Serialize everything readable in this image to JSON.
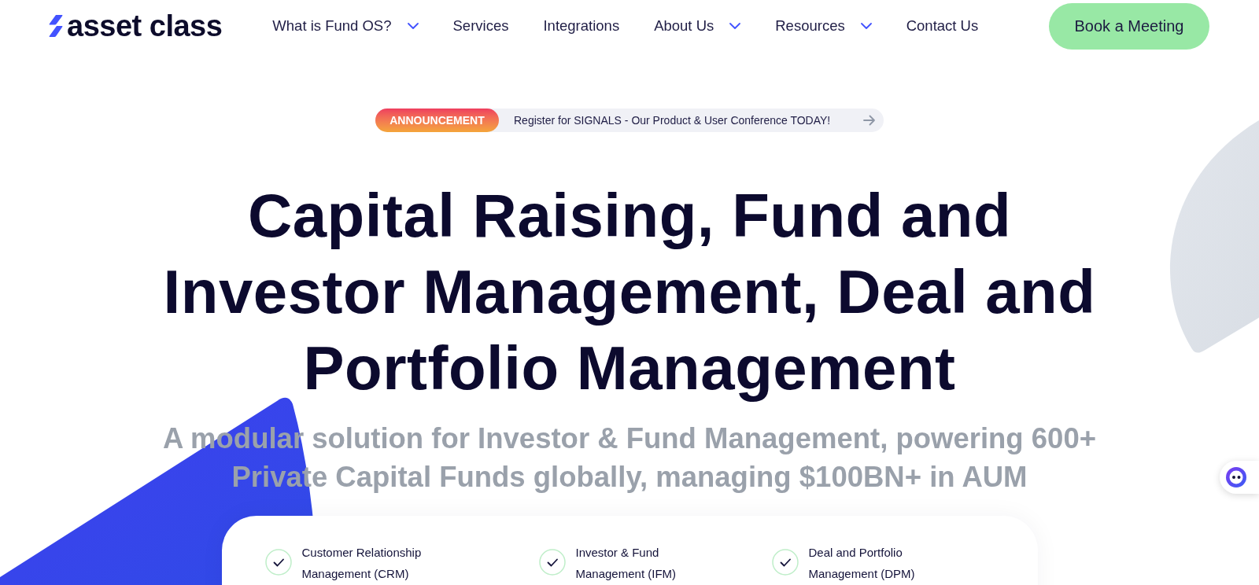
{
  "header": {
    "logo": {
      "text": "asset class"
    },
    "nav": [
      {
        "label": "What is Fund OS?",
        "dropdown": true
      },
      {
        "label": "Services",
        "dropdown": false
      },
      {
        "label": "Integrations",
        "dropdown": false
      },
      {
        "label": "About Us",
        "dropdown": true
      },
      {
        "label": "Resources",
        "dropdown": true
      },
      {
        "label": "Contact Us",
        "dropdown": false
      }
    ],
    "cta": {
      "label": "Book a Meeting"
    }
  },
  "announcement": {
    "badge": "ANNOUNCEMENT",
    "text": "Register for SIGNALS - Our Product & User Conference TODAY!"
  },
  "hero": {
    "title_lines": [
      "Capital Raising, Fund and",
      "Investor Management, Deal and",
      "Portfolio Management"
    ],
    "subtitle_lines": [
      "A modular solution for Investor & Fund Management, powering 600+",
      "Private Capital Funds globally, managing $100BN+ in AUM"
    ]
  },
  "features": [
    {
      "label": "Customer Relationship Management (CRM)"
    },
    {
      "label": "Investor & Fund Management (IFM)"
    },
    {
      "label": "Deal and Portfolio Management (DPM)"
    }
  ]
}
